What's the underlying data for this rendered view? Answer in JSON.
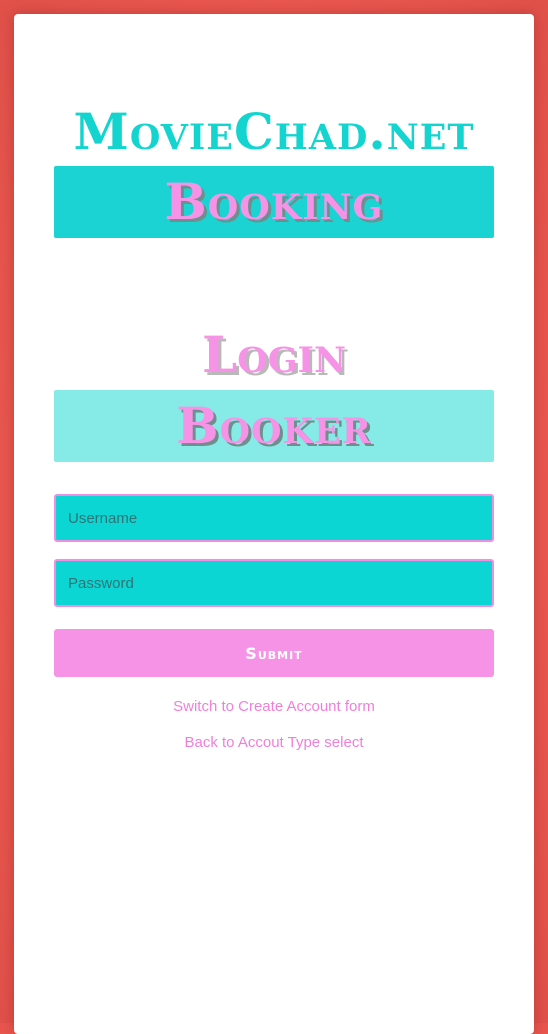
{
  "site": {
    "title": "MovieChad.net"
  },
  "banners": {
    "booking": "Booking",
    "booker": "Booker"
  },
  "form": {
    "heading": "Login",
    "username_placeholder": "Username",
    "password_placeholder": "Password",
    "submit_label": "Submit",
    "links": {
      "create_account": "Switch to Create Account form",
      "back_to_type": "Back to Accout Type select"
    }
  },
  "colors": {
    "page_background": "#e8564e",
    "card": "#ffffff",
    "teal": "#1ad3d2",
    "light_teal": "#86eae6",
    "pink": "#f793e6"
  }
}
